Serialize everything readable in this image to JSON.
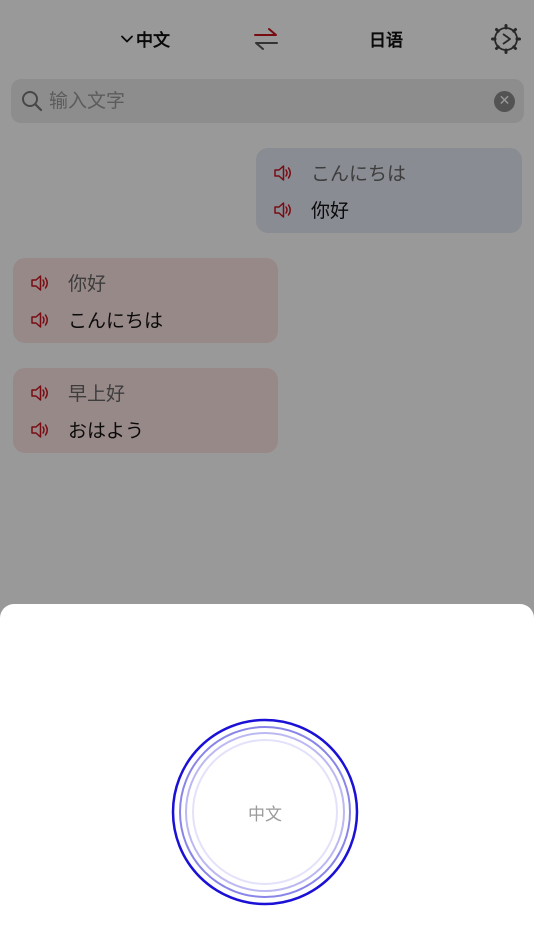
{
  "header": {
    "source_lang": "中文",
    "target_lang": "日语"
  },
  "search": {
    "placeholder": "输入文字"
  },
  "history": [
    {
      "source": "こんにちは",
      "translation": "你好"
    },
    {
      "source": "你好",
      "translation": "こんにちは"
    },
    {
      "source": "早上好",
      "translation": "おはよう"
    }
  ],
  "voice_sheet": {
    "mic_label": "中文"
  },
  "colors": {
    "accent_red": "#c8141e",
    "mic_blue": "#1a10d6",
    "bubble_right": "#e6e9f7",
    "bubble_left": "#fde4e4"
  },
  "icons": {
    "language_dropdown": "chevron-down-icon",
    "swap": "swap-arrows-icon",
    "settings": "gear-icon",
    "search": "search-icon",
    "clear": "clear-icon",
    "speak": "speaker-icon"
  }
}
